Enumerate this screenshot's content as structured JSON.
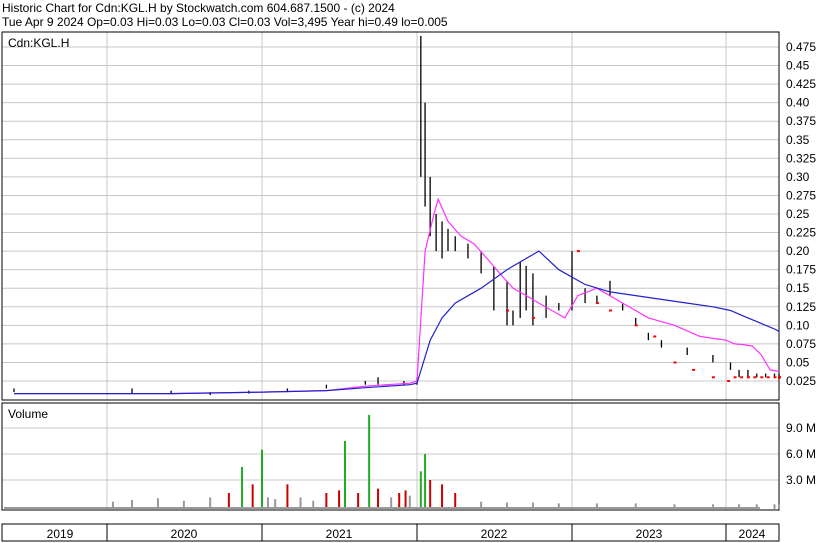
{
  "header": {
    "line1": "Historic Chart for Cdn:KGL.H by Stockwatch.com 604.687.1500 - (c) 2024",
    "line2": "Tue Apr  9 2024  Op=0.03  Hi=0.03  Lo=0.03  Cl=0.03  Vol=3,495  Year hi=0.49  lo=0.005"
  },
  "colors": {
    "background": "#ffffff",
    "grid": "#c8c8c8",
    "price_bar": "#000000",
    "flat_tick": "#ff0000",
    "ma_short": "#ff33ff",
    "ma_long": "#2222cc",
    "vol_up": "#22aa22",
    "vol_down": "#cc0000",
    "vol_flat": "#999999"
  },
  "chart_data": [
    {
      "type": "line",
      "title": "Cdn:KGL.H",
      "y_ticks": [
        "0.475",
        "0.45",
        "0.425",
        "0.40",
        "0.375",
        "0.35",
        "0.325",
        "0.30",
        "0.275",
        "0.25",
        "0.225",
        "0.20",
        "0.175",
        "0.15",
        "0.125",
        "0.10",
        "0.075",
        "0.05",
        "0.025"
      ],
      "ylim": [
        0.0,
        0.49
      ],
      "x_labels": [
        "2019",
        "2020",
        "2021",
        "2022",
        "2023",
        "2024"
      ],
      "grid": true,
      "series": [
        {
          "name": "",
          "style": "price-bars",
          "x": [
            "2018-12-20",
            "2019-03-01",
            "2019-06-01",
            "2019-09-01",
            "2019-12-01",
            "2020-03-01",
            "2020-06-01",
            "2020-09-01",
            "2020-10-01",
            "2020-12-01",
            "2021-01-01",
            "2021-01-10",
            "2021-01-20",
            "2021-02-01",
            "2021-02-15",
            "2021-03-01",
            "2021-03-15",
            "2021-04-01",
            "2021-05-01",
            "2021-06-01",
            "2021-07-01",
            "2021-08-01",
            "2021-08-15",
            "2021-09-01",
            "2021-09-15",
            "2021-10-01",
            "2021-11-01",
            "2021-12-01",
            "2022-01-01",
            "2022-02-01",
            "2022-03-01",
            "2022-04-01",
            "2022-05-01",
            "2022-06-01",
            "2022-07-01",
            "2022-08-01",
            "2022-10-01",
            "2022-12-01",
            "2023-02-01",
            "2023-04-01",
            "2023-06-01",
            "2023-08-01",
            "2023-10-01",
            "2023-12-01",
            "2024-02-01",
            "2024-04-09"
          ],
          "high": [
            0.015,
            0.015,
            0.012,
            0.01,
            0.012,
            0.015,
            0.02,
            0.025,
            0.03,
            0.025,
            0.03,
            0.49,
            0.4,
            0.3,
            0.25,
            0.24,
            0.23,
            0.22,
            0.21,
            0.2,
            0.18,
            0.16,
            0.12,
            0.185,
            0.18,
            0.17,
            0.14,
            0.13,
            0.2,
            0.15,
            0.14,
            0.16,
            0.13,
            0.11,
            0.09,
            0.08,
            0.07,
            0.06,
            0.05,
            0.04,
            0.04,
            0.035,
            0.035,
            0.035,
            0.035,
            0.03
          ],
          "low": [
            0.01,
            0.008,
            0.008,
            0.006,
            0.008,
            0.01,
            0.015,
            0.02,
            0.02,
            0.02,
            0.02,
            0.3,
            0.26,
            0.22,
            0.2,
            0.19,
            0.2,
            0.2,
            0.19,
            0.17,
            0.12,
            0.1,
            0.1,
            0.11,
            0.12,
            0.1,
            0.11,
            0.12,
            0.12,
            0.13,
            0.13,
            0.14,
            0.12,
            0.1,
            0.08,
            0.07,
            0.06,
            0.05,
            0.04,
            0.03,
            0.03,
            0.03,
            0.03,
            0.03,
            0.03,
            0.03
          ]
        },
        {
          "name": "",
          "style": "moving-average-short",
          "x": [
            "2018-12-20",
            "2019-06-01",
            "2020-01-01",
            "2020-06-01",
            "2020-09-01",
            "2020-12-15",
            "2021-01-01",
            "2021-01-20",
            "2021-02-10",
            "2021-02-20",
            "2021-03-15",
            "2021-04-15",
            "2021-05-15",
            "2021-06-15",
            "2021-07-15",
            "2021-08-15",
            "2021-09-15",
            "2021-10-15",
            "2021-11-15",
            "2021-12-15",
            "2022-01-15",
            "2022-03-01",
            "2022-05-01",
            "2022-07-01",
            "2022-09-01",
            "2022-11-01",
            "2023-01-01",
            "2023-03-01",
            "2023-05-01",
            "2023-07-01",
            "2023-09-01",
            "2023-11-01",
            "2024-01-01",
            "2024-04-09"
          ],
          "y": [
            0.008,
            0.008,
            0.01,
            0.012,
            0.018,
            0.022,
            0.025,
            0.2,
            0.25,
            0.27,
            0.24,
            0.22,
            0.21,
            0.19,
            0.17,
            0.15,
            0.14,
            0.13,
            0.12,
            0.11,
            0.14,
            0.15,
            0.13,
            0.11,
            0.1,
            0.085,
            0.08,
            0.075,
            0.074,
            0.072,
            0.06,
            0.04,
            0.038,
            0.038
          ]
        },
        {
          "name": "",
          "style": "moving-average-long",
          "x": [
            "2018-12-20",
            "2019-06-01",
            "2020-01-01",
            "2020-06-01",
            "2020-09-01",
            "2020-12-15",
            "2021-01-01",
            "2021-02-01",
            "2021-03-01",
            "2021-04-01",
            "2021-06-01",
            "2021-08-01",
            "2021-09-15",
            "2021-10-15",
            "2021-12-01",
            "2022-02-01",
            "2022-04-01",
            "2022-06-01",
            "2022-08-01",
            "2022-10-01",
            "2022-12-01",
            "2023-02-01",
            "2023-04-01",
            "2023-06-01",
            "2023-08-01",
            "2023-10-01",
            "2023-12-01",
            "2024-02-01",
            "2024-04-09"
          ],
          "y": [
            0.008,
            0.008,
            0.01,
            0.012,
            0.016,
            0.02,
            0.022,
            0.08,
            0.11,
            0.13,
            0.15,
            0.175,
            0.19,
            0.2,
            0.175,
            0.155,
            0.145,
            0.14,
            0.135,
            0.13,
            0.125,
            0.12,
            0.115,
            0.11,
            0.105,
            0.1,
            0.095,
            0.092,
            0.09
          ]
        },
        {
          "name": "",
          "style": "flat-ticks",
          "x": [
            "2021-08-01",
            "2021-10-01",
            "2022-01-15",
            "2022-03-01",
            "2022-04-01",
            "2022-06-01",
            "2022-07-15",
            "2022-09-01",
            "2022-10-15",
            "2022-12-01",
            "2023-01-15",
            "2023-03-01",
            "2023-04-15",
            "2023-06-01",
            "2023-07-15",
            "2023-09-01",
            "2023-10-15",
            "2023-12-01",
            "2024-01-15",
            "2024-03-01",
            "2024-04-09"
          ],
          "y": [
            0.12,
            0.11,
            0.2,
            0.13,
            0.12,
            0.1,
            0.085,
            0.05,
            0.04,
            0.03,
            0.025,
            0.03,
            0.03,
            0.03,
            0.03,
            0.03,
            0.03,
            0.03,
            0.03,
            0.03,
            0.03
          ]
        }
      ]
    },
    {
      "type": "bar",
      "title": "Volume",
      "y_ticks": [
        "9.0 M",
        "6.0 M",
        "3.0 M"
      ],
      "ylim": [
        0,
        11.5
      ],
      "grid": true,
      "series": [
        {
          "name": "",
          "x": [
            "2019-01-15",
            "2019-03-01",
            "2019-05-01",
            "2019-07-01",
            "2019-09-01",
            "2019-10-15",
            "2019-11-15",
            "2019-12-10",
            "2020-01-01",
            "2020-01-15",
            "2020-02-01",
            "2020-03-01",
            "2020-04-01",
            "2020-05-01",
            "2020-06-01",
            "2020-07-01",
            "2020-07-15",
            "2020-08-15",
            "2020-09-10",
            "2020-10-01",
            "2020-11-01",
            "2020-11-20",
            "2020-12-05",
            "2020-12-15",
            "2021-01-10",
            "2021-01-20",
            "2021-02-01",
            "2021-03-01",
            "2021-04-01",
            "2021-06-01",
            "2021-08-01",
            "2021-10-01",
            "2021-12-01",
            "2022-03-01",
            "2022-06-01",
            "2022-09-01",
            "2022-12-01",
            "2023-04-01",
            "2023-08-01",
            "2023-12-01",
            "2024-03-01"
          ],
          "values": [
            0.5,
            0.7,
            0.9,
            0.6,
            1.0,
            1.5,
            4.5,
            2.5,
            6.5,
            1.0,
            0.8,
            2.5,
            1.0,
            0.6,
            1.5,
            1.8,
            7.5,
            1.5,
            10.5,
            2.0,
            1.0,
            1.5,
            1.8,
            1.2,
            4.0,
            6.0,
            3.0,
            2.5,
            1.5,
            0.5,
            0.4,
            0.4,
            0.3,
            0.3,
            0.3,
            0.2,
            0.2,
            0.2,
            0.2,
            0.2,
            0.2
          ]
        }
      ]
    }
  ]
}
